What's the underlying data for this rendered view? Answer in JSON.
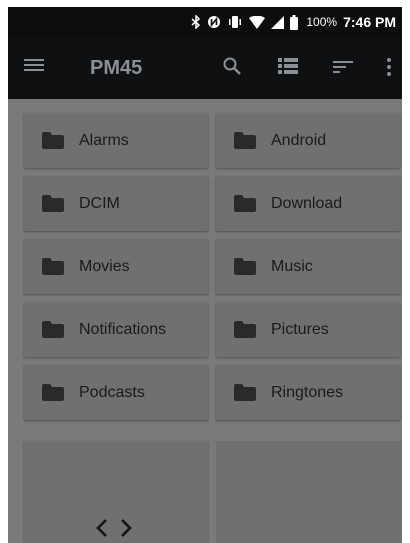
{
  "status_bar": {
    "icons": [
      "bluetooth-icon",
      "nfc-icon",
      "vibrate-icon",
      "wifi-icon",
      "signal-icon",
      "battery-icon"
    ],
    "battery_percent": "100%",
    "time": "7:46 PM"
  },
  "toolbar": {
    "title": "PM45",
    "icons": [
      "menu-icon",
      "search-icon",
      "list-view-icon",
      "sort-icon",
      "more-vert-icon"
    ]
  },
  "folders": [
    {
      "name": "Alarms"
    },
    {
      "name": "Android"
    },
    {
      "name": "DCIM"
    },
    {
      "name": "Download"
    },
    {
      "name": "Movies"
    },
    {
      "name": "Music"
    },
    {
      "name": "Notifications"
    },
    {
      "name": "Pictures"
    },
    {
      "name": "Podcasts"
    },
    {
      "name": "Ringtones"
    }
  ],
  "extra_item": {
    "icon": "code-icon"
  },
  "colors": {
    "toolbar_bg": "#0f1012",
    "status_bg": "#0d0d0d",
    "title": "#8a8f97",
    "dim_overlay": "#7a7a7a",
    "card": "#707070",
    "folder_icon": "#2a2a2a"
  }
}
